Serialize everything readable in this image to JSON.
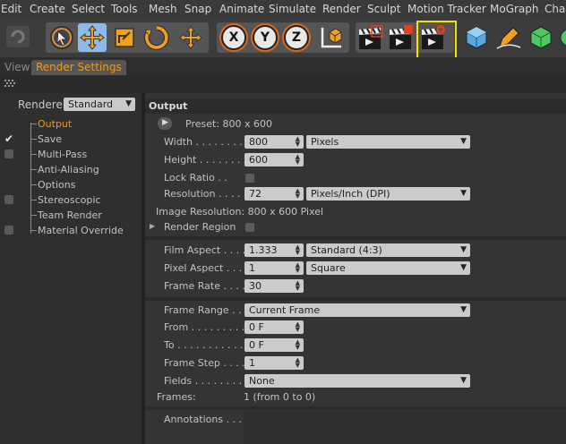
{
  "menu": [
    "Edit",
    "Create",
    "Select",
    "Tools",
    "Mesh",
    "Snap",
    "Animate",
    "Simulate",
    "Render",
    "Sculpt",
    "Motion Tracker",
    "MoGraph",
    "Char"
  ],
  "toolbar": {
    "icons": [
      "undo-icon",
      "live-selection-icon",
      "move-icon",
      "scale-icon",
      "rotate-icon",
      "move-all-icon",
      "x-axis-lock-icon",
      "y-axis-lock-icon",
      "z-axis-lock-icon",
      "world-coordinates-icon",
      "render-view-icon",
      "render-to-picture-viewer-icon",
      "edit-render-settings-icon",
      "cube-icon",
      "pen-icon",
      "subdivision-icon"
    ],
    "axis_x": "X",
    "axis_y": "Y",
    "axis_z": "Z",
    "highlight_color": "#f2e400",
    "accent_color": "#d86a1c"
  },
  "tabs": [
    {
      "label": "View",
      "active": false
    },
    {
      "label": "Render Settings",
      "active": true
    }
  ],
  "left": {
    "renderer_label": "Renderer",
    "renderer_value": "Standard",
    "tree": [
      {
        "label": "Output",
        "selected": true,
        "check": "none"
      },
      {
        "label": "Save",
        "selected": false,
        "check": "checked"
      },
      {
        "label": "Multi-Pass",
        "selected": false,
        "check": "unchecked"
      },
      {
        "label": "Anti-Aliasing",
        "selected": false,
        "check": "none"
      },
      {
        "label": "Options",
        "selected": false,
        "check": "none"
      },
      {
        "label": "Stereoscopic",
        "selected": false,
        "check": "unchecked"
      },
      {
        "label": "Team Render",
        "selected": false,
        "check": "none"
      },
      {
        "label": "Material Override",
        "selected": false,
        "check": "unchecked"
      }
    ],
    "selected_color": "#f09a1e"
  },
  "output": {
    "title": "Output",
    "preset": "Preset: 800 x 600",
    "width_label": "Width . . . . . . . . .",
    "width": "800",
    "width_unit": "Pixels",
    "height_label": "Height . . . . . . . . .",
    "height": "600",
    "lock_ratio_label": "Lock Ratio . .",
    "resolution_label": "Resolution . . . . .",
    "resolution": "72",
    "resolution_unit": "Pixels/Inch (DPI)",
    "image_resolution": "Image Resolution: 800 x 600 Pixel",
    "render_region_label": "Render Region",
    "film_aspect_label": "Film Aspect . . . .",
    "film_aspect": "1.333",
    "film_aspect_preset": "Standard (4:3)",
    "pixel_aspect_label": "Pixel Aspect . . . .",
    "pixel_aspect": "1",
    "pixel_aspect_preset": "Square",
    "frame_rate_label": "Frame Rate . . . .",
    "frame_rate": "30",
    "frame_range_label": "Frame Range . . . .",
    "frame_range": "Current Frame",
    "from_label": "From . . . . . . . . . . .",
    "from": "0 F",
    "to_label": "To . . . . . . . . . . . . .",
    "to": "0 F",
    "frame_step_label": "Frame Step . . . .",
    "frame_step": "1",
    "fields_label": "Fields . . . . . . . . .",
    "fields": "None",
    "frames_label": "Frames:",
    "frames_value": "1 (from 0 to 0)",
    "annotations_label": "Annotations . . . ."
  }
}
